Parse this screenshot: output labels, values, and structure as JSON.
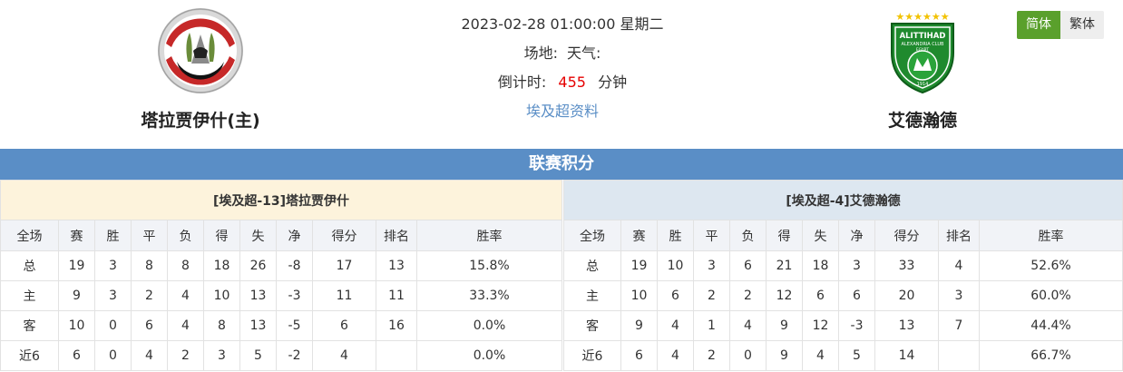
{
  "match": {
    "datetime": "2023-02-28 01:00:00 星期二",
    "venue_label": "场地:",
    "weather_label": "天气:",
    "countdown_label": "倒计时:",
    "countdown_value": "455",
    "countdown_unit": "分钟",
    "league_link": "埃及超资料"
  },
  "home_team": {
    "name": "塔拉贾伊什(主)"
  },
  "away_team": {
    "name": "艾德瀚德",
    "badge_text_1": "ALITTIHAD",
    "badge_text_2": "ALEXANDRIA CLUB",
    "badge_text_3": "EGYPT",
    "badge_year": "1914"
  },
  "lang": {
    "simplified": "简体",
    "traditional": "繁体"
  },
  "section_title": "联赛积分",
  "columns": [
    "全场",
    "赛",
    "胜",
    "平",
    "负",
    "得",
    "失",
    "净",
    "得分",
    "排名",
    "胜率"
  ],
  "home_table": {
    "caption": "[埃及超-13]塔拉贾伊什",
    "rows": [
      [
        "总",
        "19",
        "3",
        "8",
        "8",
        "18",
        "26",
        "-8",
        "17",
        "13",
        "15.8%"
      ],
      [
        "主",
        "9",
        "3",
        "2",
        "4",
        "10",
        "13",
        "-3",
        "11",
        "11",
        "33.3%"
      ],
      [
        "客",
        "10",
        "0",
        "6",
        "4",
        "8",
        "13",
        "-5",
        "6",
        "16",
        "0.0%"
      ],
      [
        "近6",
        "6",
        "0",
        "4",
        "2",
        "3",
        "5",
        "-2",
        "4",
        "",
        "0.0%"
      ]
    ]
  },
  "away_table": {
    "caption": "[埃及超-4]艾德瀚德",
    "rows": [
      [
        "总",
        "19",
        "10",
        "3",
        "6",
        "21",
        "18",
        "3",
        "33",
        "4",
        "52.6%"
      ],
      [
        "主",
        "10",
        "6",
        "2",
        "2",
        "12",
        "6",
        "6",
        "20",
        "3",
        "60.0%"
      ],
      [
        "客",
        "9",
        "4",
        "1",
        "4",
        "9",
        "12",
        "-3",
        "13",
        "7",
        "44.4%"
      ],
      [
        "近6",
        "6",
        "4",
        "2",
        "0",
        "9",
        "4",
        "5",
        "14",
        "",
        "66.7%"
      ]
    ]
  },
  "colors": {
    "accent_blue": "#5a8ec6",
    "active_green": "#5aa02c",
    "countdown_red": "#e60000"
  }
}
